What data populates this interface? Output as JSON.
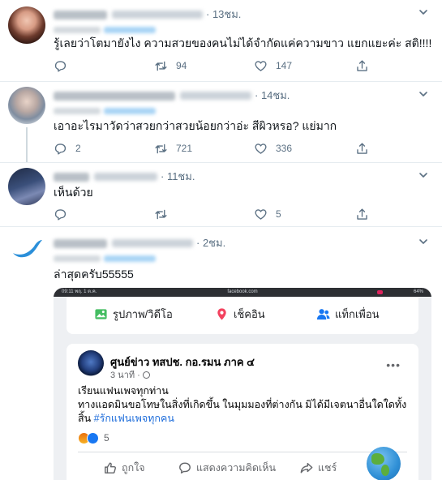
{
  "tweets": [
    {
      "time": "· 13ชม.",
      "text": "รู้เลยว่าโตมายังไง ความสวยของคนไม่ได้จำกัดแค่ความขาว แยกแยะค่ะ สติ!!!!",
      "reply": "",
      "retweets": "",
      "retweet_count": "94",
      "likes": "147",
      "share": ""
    },
    {
      "time": "· 14ชม.",
      "text": "เอาอะไรมาวัดว่าสวยกว่าสวยน้อยกว่าอ่ะ สีผิวหรอ? แย่มาก",
      "reply_count": "2",
      "retweet_count": "721",
      "likes": "336"
    },
    {
      "time": "· 11ชม.",
      "text": "เห็นด้วย",
      "likes": "5"
    },
    {
      "time": "· 2ชม.",
      "text": "ล่าสุดครับ55555"
    }
  ],
  "embed": {
    "status_left": "09:11  พฤ. 1 ต.ค.",
    "status_center": "facebook.com",
    "status_right": "64%",
    "composer": {
      "photo_label": "รูปภาพ/วิดีโอ",
      "checkin_label": "เช็คอิน",
      "tag_label": "แท็กเพื่อน"
    },
    "post": {
      "page_name": "ศูนย์ข่าว ทสปช. กอ.รมน ภาค ๔",
      "meta": "3 นาที · ",
      "line1": "เรียนแฟนเพจทุกท่าน",
      "line2": "ทางแอดมินขอโทษในสิ่งที่เกิดขึ้น ในมุมมองที่ต่างกัน มิได้มีเจตนาอื่นใดใดทั้ง",
      "line3_prefix": "สิ้น ",
      "hashtag": "#รักแฟนเพจทุกคน",
      "reaction_count": "5",
      "like_label": "ถูกใจ",
      "comment_label": "แสดงความคิดเห็น",
      "share_label": "แชร์"
    }
  },
  "colors": {
    "text": "#0f1419",
    "muted": "#5b7083",
    "link": "#1da1f2",
    "fb_blue": "#216fdb",
    "divider": "#e6ecf0"
  }
}
